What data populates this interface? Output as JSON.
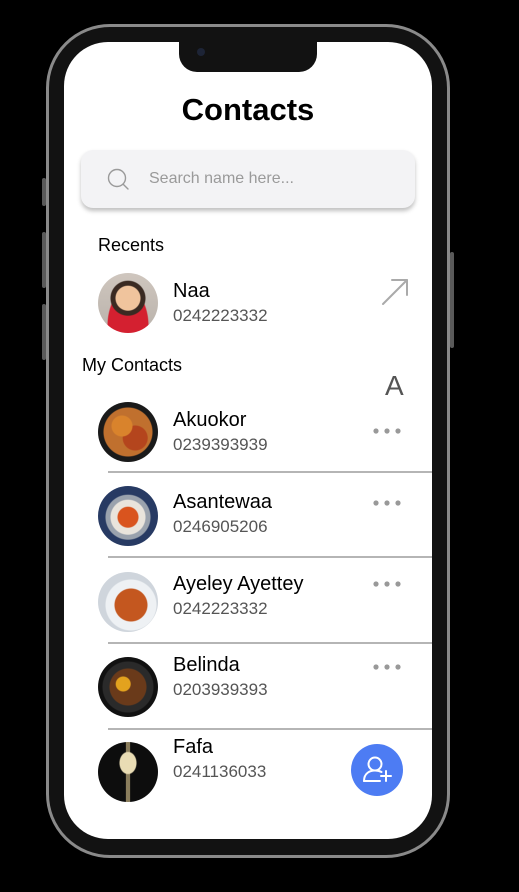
{
  "header": {
    "title": "Contacts"
  },
  "search": {
    "placeholder": "Search name here...",
    "icon": "search-icon"
  },
  "recents": {
    "label": "Recents",
    "items": [
      {
        "name": "Naa",
        "phone": "0242223332",
        "action_icon": "arrow-up-right-icon"
      }
    ]
  },
  "my_contacts": {
    "label": "My Contacts",
    "index_letter": "A",
    "items": [
      {
        "name": "Akuokor",
        "phone": "0239393939"
      },
      {
        "name": "Asantewaa",
        "phone": "0246905206"
      },
      {
        "name": "Ayeley Ayettey",
        "phone": "0242223332"
      },
      {
        "name": "Belinda",
        "phone": "0203939393"
      },
      {
        "name": "Fafa",
        "phone": "0241136033"
      }
    ]
  },
  "fab": {
    "icon": "add-user-icon",
    "color": "#4d7cf3"
  }
}
